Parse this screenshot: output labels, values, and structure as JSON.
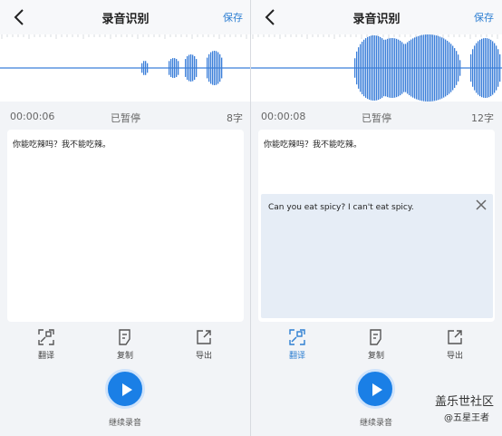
{
  "left": {
    "header": {
      "title": "录音识别",
      "save_label": "保存"
    },
    "status": {
      "time": "00:00:06",
      "state": "已暂停",
      "count": "8字"
    },
    "transcript": "你能吃辣吗？我不能吃辣。",
    "toolbar": [
      {
        "label": "翻译",
        "icon": "translate-icon",
        "active": false
      },
      {
        "label": "复制",
        "icon": "copy-icon",
        "active": false
      },
      {
        "label": "导出",
        "icon": "export-icon",
        "active": false
      }
    ],
    "record_label": "继续录音"
  },
  "right": {
    "header": {
      "title": "录音识别",
      "save_label": "保存"
    },
    "status": {
      "time": "00:00:08",
      "state": "已暂停",
      "count": "12字"
    },
    "transcript": "你能吃辣吗？我不能吃辣。",
    "translation": "Can you eat spicy? I can't eat spicy.",
    "toolbar": [
      {
        "label": "翻译",
        "icon": "translate-icon",
        "active": true
      },
      {
        "label": "复制",
        "icon": "copy-icon",
        "active": false
      },
      {
        "label": "导出",
        "icon": "export-icon",
        "active": false
      }
    ],
    "record_label": "继续录音"
  },
  "watermark": {
    "line1": "盖乐世社区",
    "line2": "@五星王者"
  },
  "colors": {
    "accent": "#2e7fd2",
    "wave": "#3b7fd9",
    "record": "#1a7fe6"
  }
}
